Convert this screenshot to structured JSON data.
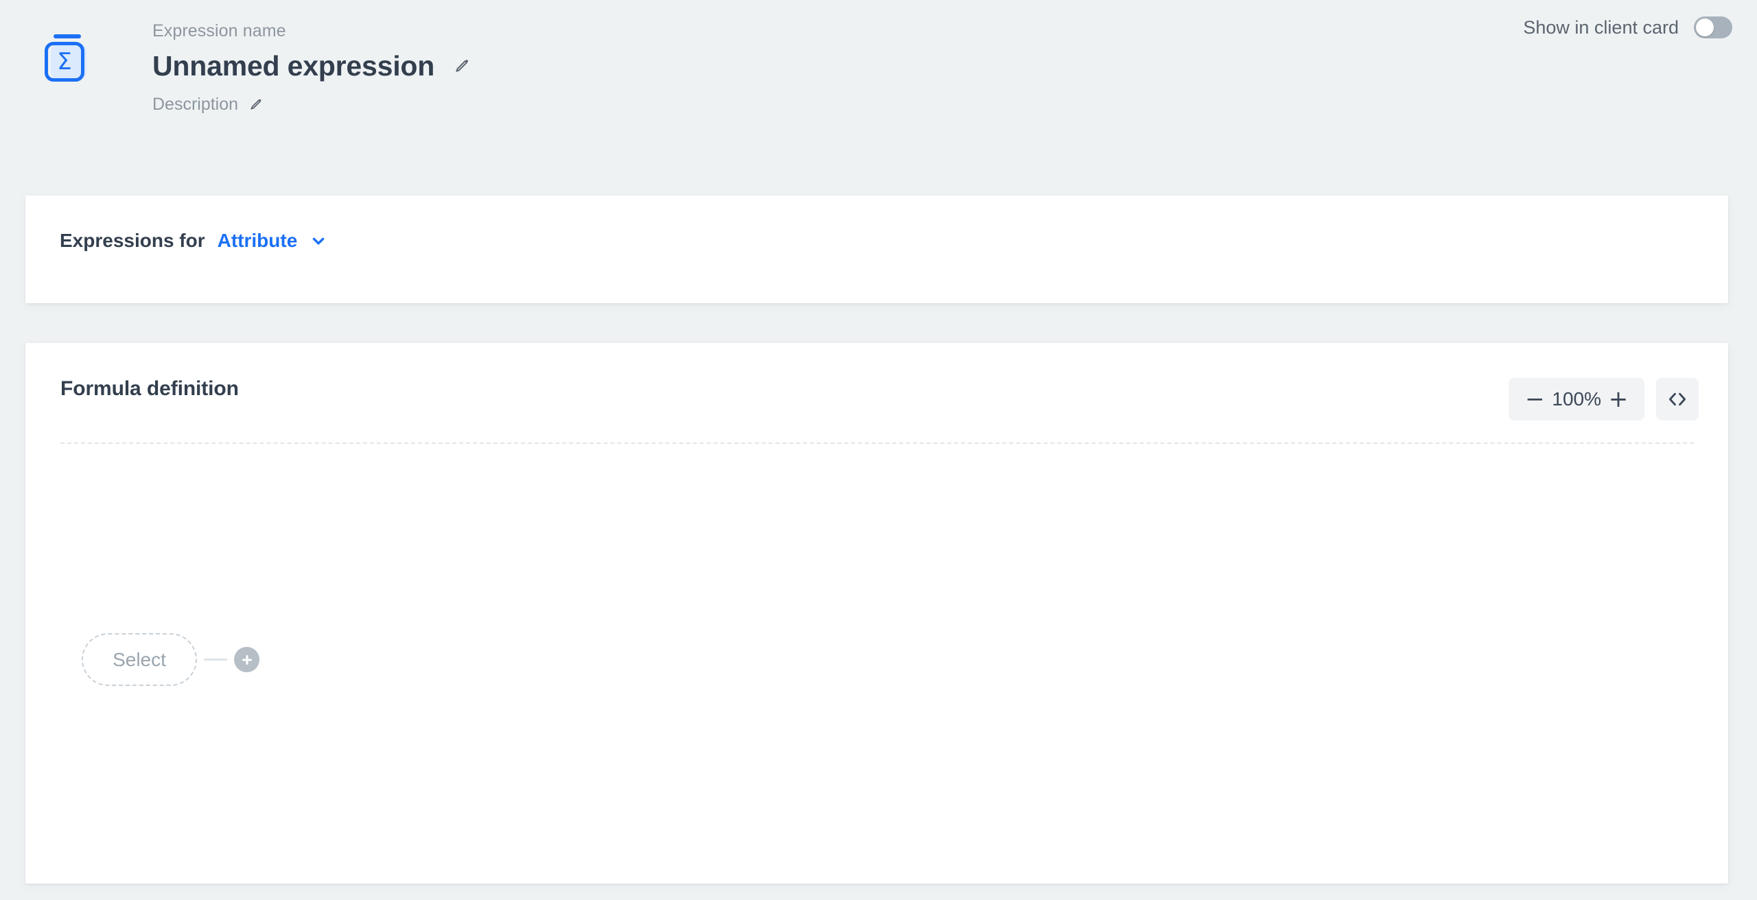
{
  "header": {
    "icon_name": "expression-sigma-icon",
    "name_label": "Expression name",
    "expression_name": "Unnamed expression",
    "edit_name_icon": "pencil-icon",
    "description_label": "Description",
    "edit_description_icon": "pencil-icon",
    "show_in_client_card_label": "Show in client card",
    "show_in_client_card_state": "off"
  },
  "expressions_for": {
    "label": "Expressions for",
    "selected": "Attribute",
    "dropdown_icon": "chevron-down-icon"
  },
  "formula": {
    "title": "Formula definition",
    "zoom_out_label": "−",
    "zoom_value": "100%",
    "zoom_in_label": "+",
    "code_view_icon": "code-brackets-icon",
    "node_placeholder": "Select",
    "add_node_icon": "plus-icon"
  },
  "colors": {
    "page_background": "#eff2f3",
    "card_background": "#ffffff",
    "accent_blue": "#1b70f5",
    "icon_backdrop_blue": "#dbeafe",
    "text_dark": "#333f4e",
    "text_muted": "#8d969f",
    "toggle_track_off": "#a8b2bc",
    "control_background": "#f1f3f5",
    "node_border": "#c9d1d8",
    "add_button_background": "#b6bec6"
  }
}
